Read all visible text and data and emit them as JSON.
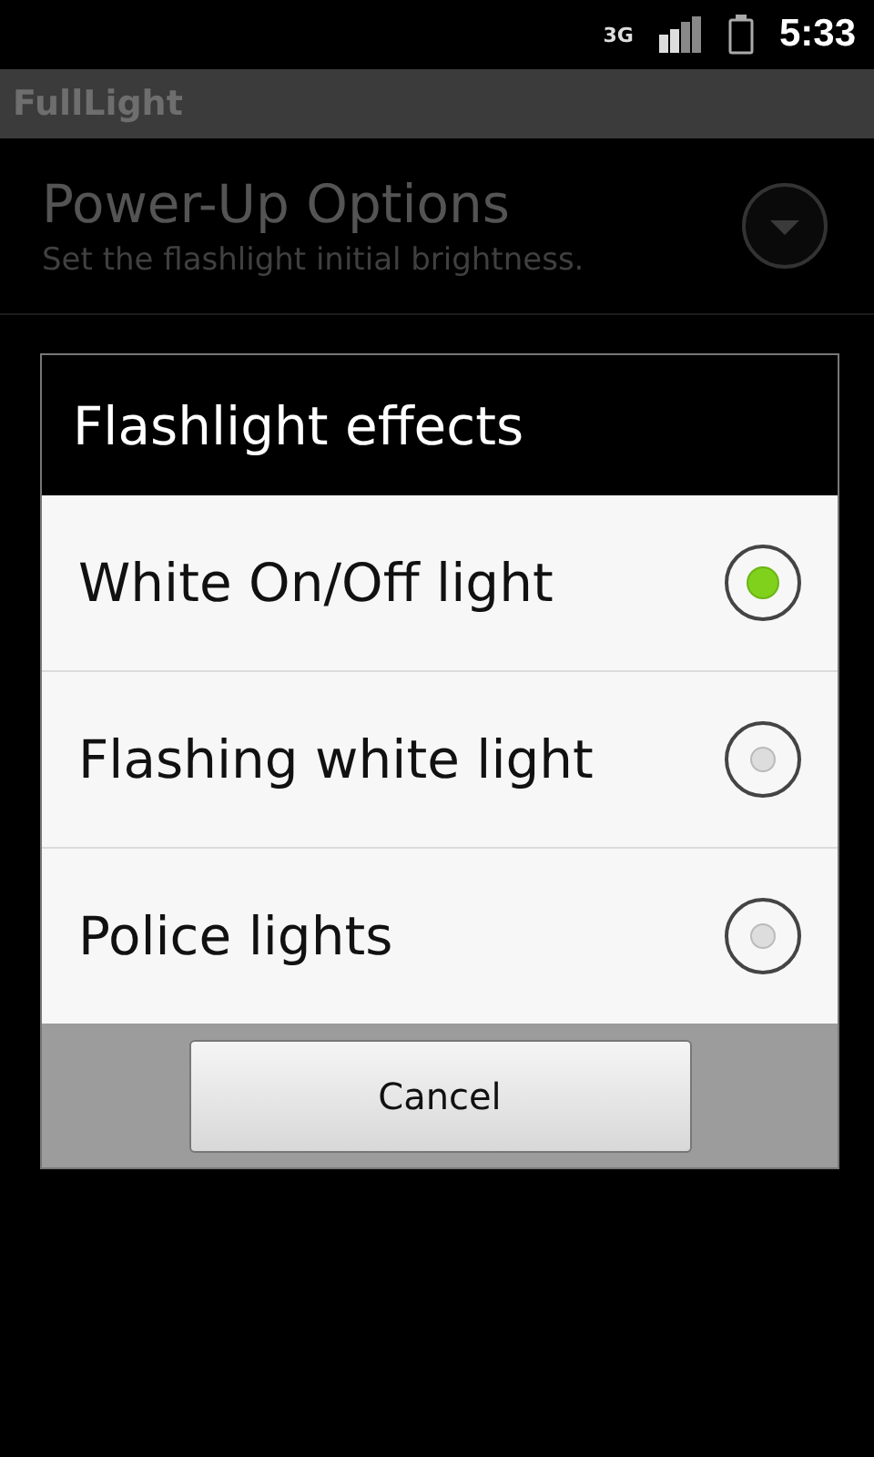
{
  "status_bar": {
    "time": "5:33",
    "network": "3G"
  },
  "app_bar": {
    "title": "FullLight"
  },
  "preferences": [
    {
      "title": "Power-Up Options",
      "summary": "Set the flashlight initial brightness."
    }
  ],
  "dialog": {
    "title": "Flashlight effects",
    "options": [
      {
        "label": "White On/Off light",
        "selected": true
      },
      {
        "label": "Flashing white light",
        "selected": false
      },
      {
        "label": "Police lights",
        "selected": false
      }
    ],
    "buttons": [
      "Cancel"
    ]
  }
}
